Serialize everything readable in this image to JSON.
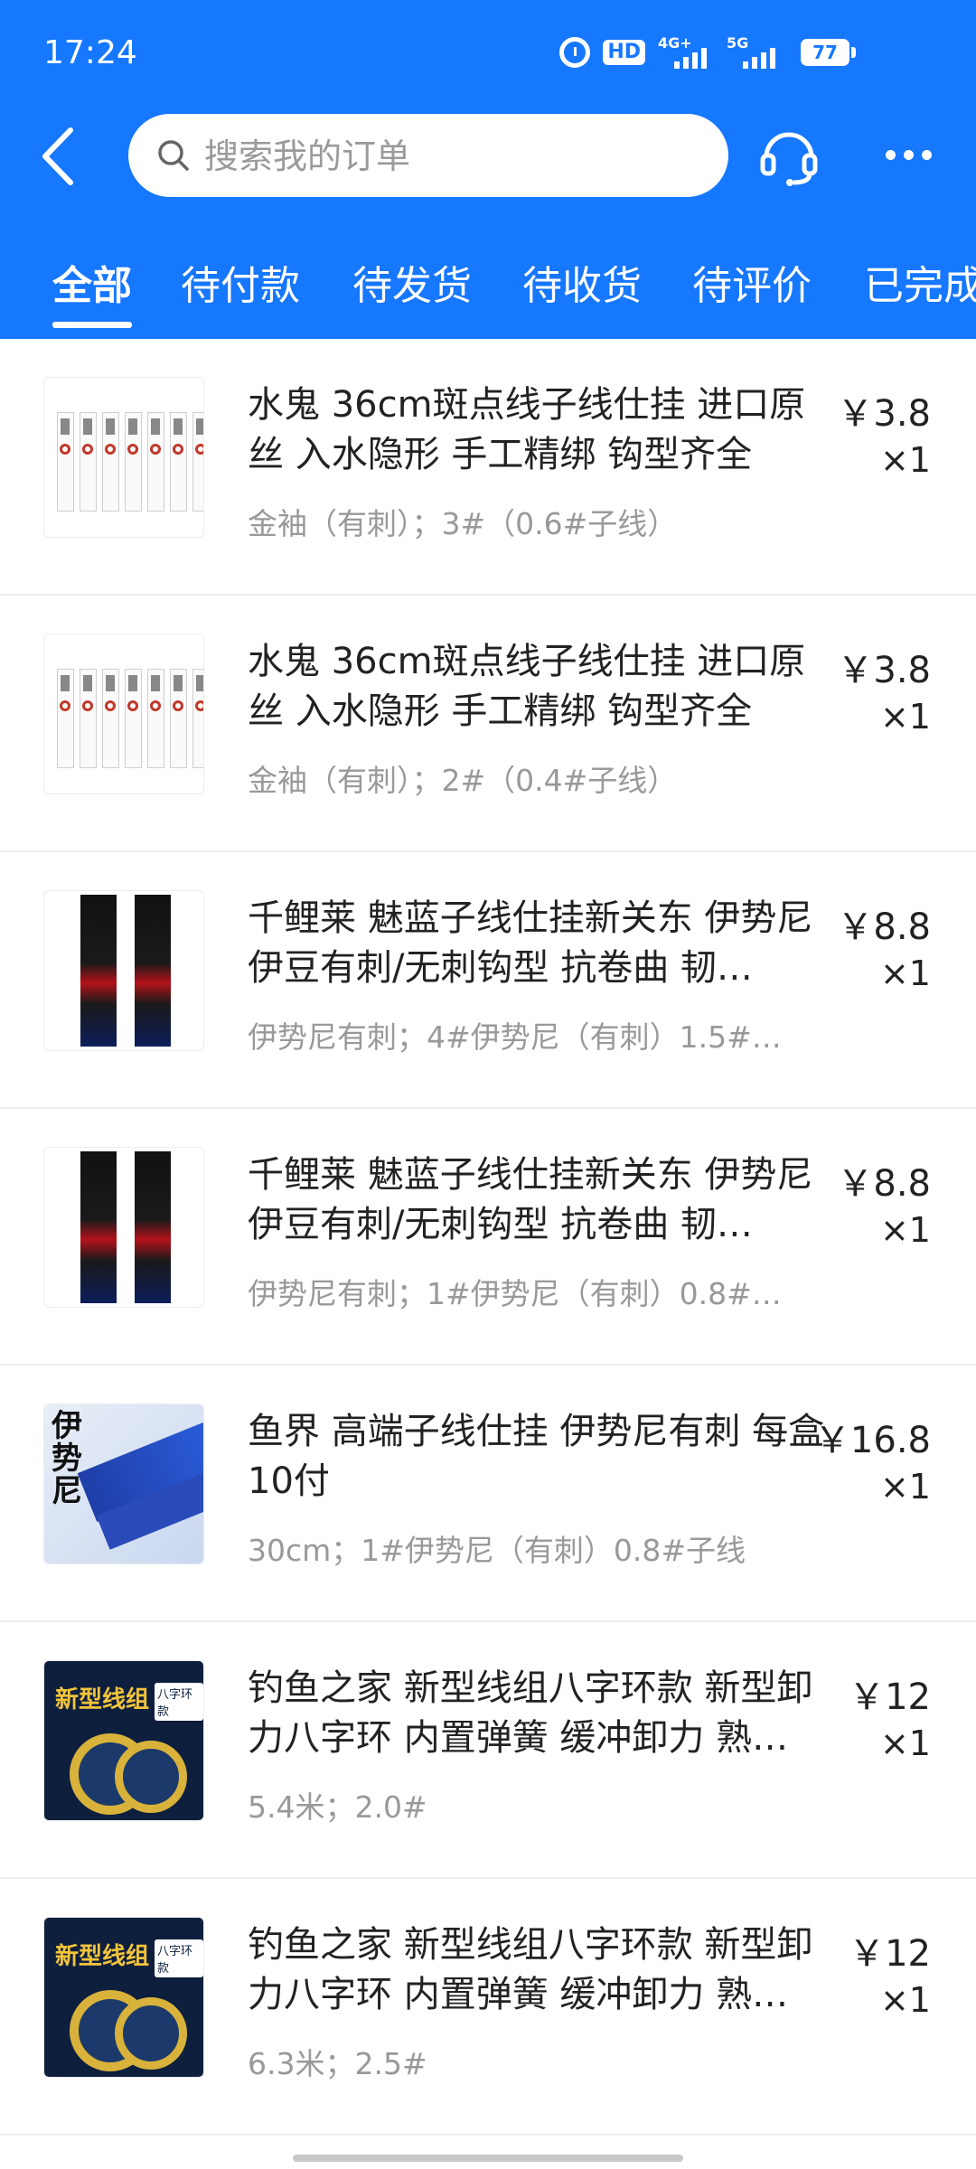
{
  "status_bar": {
    "time": "17:24",
    "hd_label": "HD",
    "net1": "4G+",
    "net2": "5G",
    "battery": "77"
  },
  "search": {
    "placeholder": "搜索我的订单"
  },
  "tabs": [
    {
      "label": "全部",
      "active": true
    },
    {
      "label": "待付款"
    },
    {
      "label": "待发货"
    },
    {
      "label": "待收货"
    },
    {
      "label": "待评价"
    },
    {
      "label": "已完成"
    }
  ],
  "orders": [
    {
      "title": "水鬼 36cm斑点线子线仕挂 进口原丝 入水隐形 手工精绑 钩型齐全",
      "spec": "金袖（有刺）；3#（0.6#子线）",
      "price": "￥3.8",
      "qty": "×1",
      "thumb": "hook-packs"
    },
    {
      "title": "水鬼 36cm斑点线子线仕挂 进口原丝 入水隐形 手工精绑 钩型齐全",
      "spec": "金袖（有刺）；2#（0.4#子线）",
      "price": "￥3.8",
      "qty": "×1",
      "thumb": "hook-packs"
    },
    {
      "title": "千鲤莱 魅蓝子线仕挂新关东 伊势尼 伊豆有刺/无刺钩型 抗卷曲 韧…",
      "spec": "伊势尼有刺；4#伊势尼（有刺）1.5#…",
      "price": "￥8.8",
      "qty": "×1",
      "thumb": "black-packs"
    },
    {
      "title": "千鲤莱 魅蓝子线仕挂新关东 伊势尼 伊豆有刺/无刺钩型 抗卷曲 韧…",
      "spec": "伊势尼有刺；1#伊势尼（有刺）0.8#…",
      "price": "￥8.8",
      "qty": "×1",
      "thumb": "black-packs"
    },
    {
      "title": "鱼界 高端子线仕挂 伊势尼有刺 每盒10付",
      "spec": "30cm；1#伊势尼（有刺）0.8#子线",
      "price": "￥16.8",
      "qty": "×1",
      "thumb": "blue-box",
      "thumb_text": "伊势尼"
    },
    {
      "title": "钓鱼之家 新型线组八字环款 新型卸力八字环  内置弹簧 缓冲卸力 熟…",
      "spec": "5.4米；2.0#",
      "price": "￥12",
      "qty": "×1",
      "thumb": "navy-spools",
      "thumb_text": "新型线组",
      "thumb_tag": "八字环款"
    },
    {
      "title": "钓鱼之家 新型线组八字环款 新型卸力八字环  内置弹簧 缓冲卸力 熟…",
      "spec": "6.3米；2.5#",
      "price": "￥12",
      "qty": "×1",
      "thumb": "navy-spools",
      "thumb_text": "新型线组",
      "thumb_tag": "八字环款"
    }
  ],
  "colors": {
    "brand": "#1677ff"
  }
}
